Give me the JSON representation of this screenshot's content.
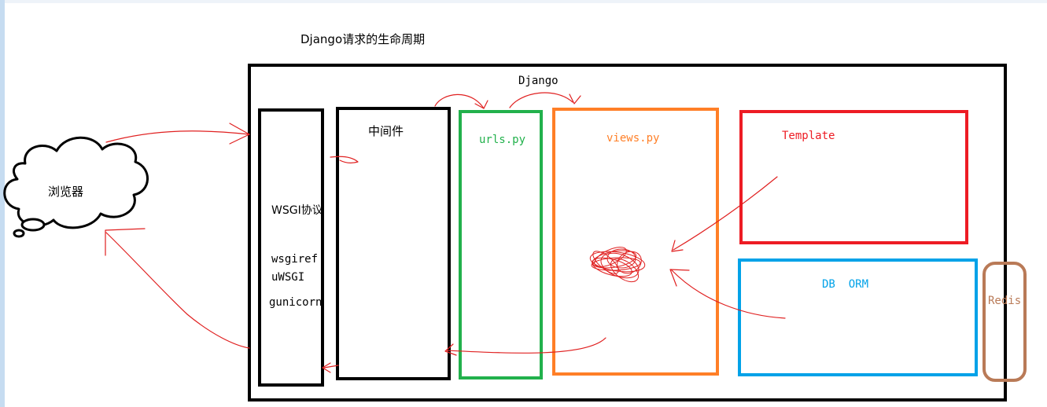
{
  "title": "Django请求的生命周期",
  "colors": {
    "frame": "#000000",
    "wsgi": "#000000",
    "middleware": "#000000",
    "urls": "#22b14c",
    "views": "#ff7f27",
    "template": "#ed1c24",
    "db": "#00a2e8",
    "redis": "#b97a57",
    "arrows": "#e02020"
  },
  "browser": {
    "label": "浏览器",
    "icon": "cloud-icon"
  },
  "django": {
    "label": "Django"
  },
  "wsgi": {
    "label": "WSGI协议",
    "servers": [
      "wsgiref",
      "uWSGI",
      "gunicorn"
    ]
  },
  "middleware": {
    "label": "中间件"
  },
  "urls": {
    "label": "urls.py"
  },
  "views": {
    "label": "views.py"
  },
  "template": {
    "label": "Template"
  },
  "db": {
    "label": "DB  ORM"
  },
  "redis": {
    "label": "Redis"
  }
}
